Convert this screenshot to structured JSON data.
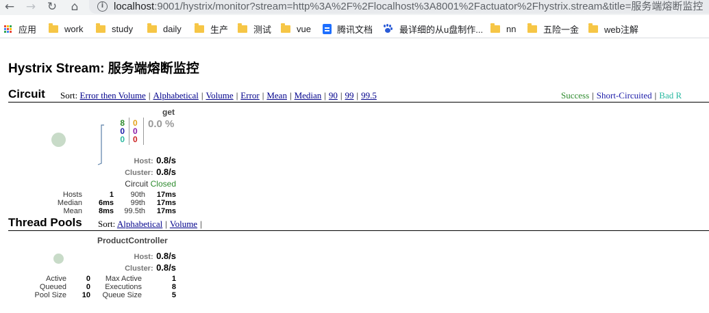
{
  "browser": {
    "nav": {
      "back": "←",
      "forward": "→",
      "reload": "↻",
      "home": "⌂"
    },
    "url_host": "localhost",
    "url_rest": ":9001/hystrix/monitor?stream=http%3A%2F%2Flocalhost%3A8001%2Factuator%2Fhystrix.stream&title=服务端熔断监控",
    "bookmarks": [
      {
        "label": "应用",
        "icon": "apps-icon"
      },
      {
        "label": "work",
        "icon": "folder-icon"
      },
      {
        "label": "study",
        "icon": "folder-icon"
      },
      {
        "label": "daily",
        "icon": "folder-icon"
      },
      {
        "label": "生产",
        "icon": "folder-icon"
      },
      {
        "label": "测试",
        "icon": "folder-icon"
      },
      {
        "label": "vue",
        "icon": "folder-icon"
      },
      {
        "label": "腾讯文档",
        "icon": "doc-icon"
      },
      {
        "label": "最详细的从u盘制作...",
        "icon": "paw-icon"
      },
      {
        "label": "nn",
        "icon": "folder-icon"
      },
      {
        "label": "五险一金",
        "icon": "folder-icon"
      },
      {
        "label": "web注解",
        "icon": "folder-icon"
      }
    ]
  },
  "page": {
    "title": "Hystrix Stream: 服务端熔断监控"
  },
  "circuit": {
    "header": "Circuit",
    "sort_label": "Sort:",
    "sort_options": [
      "Error then Volume",
      "Alphabetical",
      "Volume",
      "Error",
      "Mean",
      "Median",
      "90",
      "99",
      "99.5"
    ],
    "legend": [
      {
        "label": "Success",
        "color": "#2e8b2e"
      },
      {
        "label": "Short-Circuited",
        "color": "#1c1ca8"
      },
      {
        "label": "Bad R",
        "color": "#28b8a0"
      }
    ],
    "card": {
      "name": "get",
      "counts_left": [
        {
          "value": "8",
          "color": "#2e8b2e"
        },
        {
          "value": "0",
          "color": "#1c1ca8"
        },
        {
          "value": "0",
          "color": "#28b8a0"
        }
      ],
      "counts_right": [
        {
          "value": "0",
          "color": "#e3a21a"
        },
        {
          "value": "0",
          "color": "#8b1ca8"
        },
        {
          "value": "0",
          "color": "#cc2222"
        }
      ],
      "error_pct": "0.0 %",
      "host_label": "Host:",
      "host_rate": "0.8/s",
      "cluster_label": "Cluster:",
      "cluster_rate": "0.8/s",
      "circuit_label": "Circuit",
      "circuit_status": "Closed",
      "stats": [
        {
          "l1": "Hosts",
          "v1": "1",
          "l2": "90th",
          "v2": "17ms"
        },
        {
          "l1": "Median",
          "v1": "6ms",
          "l2": "99th",
          "v2": "17ms"
        },
        {
          "l1": "Mean",
          "v1": "8ms",
          "l2": "99.5th",
          "v2": "17ms"
        }
      ]
    }
  },
  "thread_pools": {
    "header": "Thread Pools",
    "sort_label": "Sort:",
    "sort_options": [
      "Alphabetical",
      "Volume"
    ],
    "card": {
      "name": "ProductController",
      "host_label": "Host:",
      "host_rate": "0.8/s",
      "cluster_label": "Cluster:",
      "cluster_rate": "0.8/s",
      "stats": [
        {
          "l1": "Active",
          "v1": "0",
          "l2": "Max Active",
          "v2": "1"
        },
        {
          "l1": "Queued",
          "v1": "0",
          "l2": "Executions",
          "v2": "8"
        },
        {
          "l1": "Pool Size",
          "v1": "10",
          "l2": "Queue Size",
          "v2": "5"
        }
      ]
    }
  }
}
